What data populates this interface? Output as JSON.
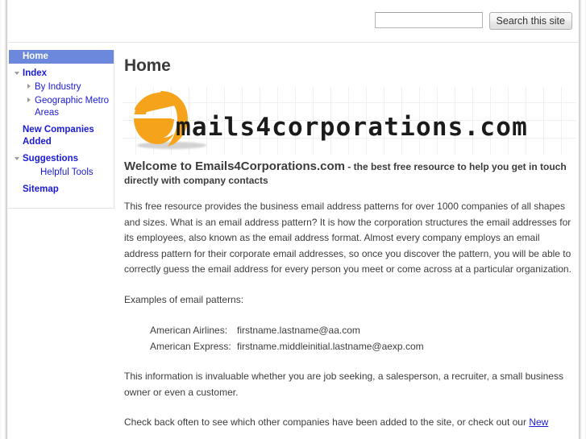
{
  "search": {
    "value": "",
    "placeholder": "",
    "button_label": "Search this site"
  },
  "sidebar": {
    "items": [
      {
        "label": "Home",
        "level": "top",
        "selected": true,
        "marker": "none"
      },
      {
        "label": "Index",
        "level": "top",
        "selected": false,
        "marker": "triangle-down"
      },
      {
        "label": "By Industry",
        "level": "child",
        "selected": false,
        "marker": "triangle-right"
      },
      {
        "label": "Geographic Metro Areas",
        "level": "child",
        "selected": false,
        "marker": "triangle-right"
      },
      {
        "label": "New Companies Added",
        "level": "top",
        "selected": false,
        "marker": "none"
      },
      {
        "label": "Suggestions",
        "level": "top",
        "selected": false,
        "marker": "triangle-down"
      },
      {
        "label": "Helpful Tools",
        "level": "child2",
        "selected": false,
        "marker": "none"
      },
      {
        "label": "Sitemap",
        "level": "top",
        "selected": false,
        "marker": "none"
      }
    ]
  },
  "main": {
    "page_title": "Home",
    "logo": {
      "mark": "orange-e-logo",
      "text": "mails4corporations.com"
    },
    "welcome": {
      "lead": "Welcome to Emails4Corporations.com",
      "rest": " - the best free resource to help you get in touch directly with company contacts"
    },
    "paragraph1": "This free resource provides the business email address patterns for over 1000 companies of all shapes and sizes.   What is an email address pattern?  It is how the corporation structures the email addresses for its employees, also known as the email address format.  Almost every company employs an email address pattern for their corporate email addresses, so once you discover the pattern, you will be able to correctly guess the email address for every person you meet or come across at a particular organization.",
    "examples_heading": "Examples of email patterns:",
    "examples": [
      {
        "company": "American Airlines:",
        "pattern": "firstname.lastname@aa.com"
      },
      {
        "company": "American Express:",
        "pattern": "firstname.middleinitial.lastname@aexp.com"
      }
    ],
    "paragraph2": "This information is invaluable whether you are job seeking, a salesperson, a recruiter, a small business owner or even a customer.",
    "paragraph3_before": "Check back often to see which other companies have been added to the site, or check out our ",
    "paragraph3_link": "New"
  },
  "colors": {
    "selected_nav_bg": "#6b88dd",
    "link": "#1a1ad6",
    "logo_orange": "#f5a31a",
    "text": "#3d3d3d"
  }
}
